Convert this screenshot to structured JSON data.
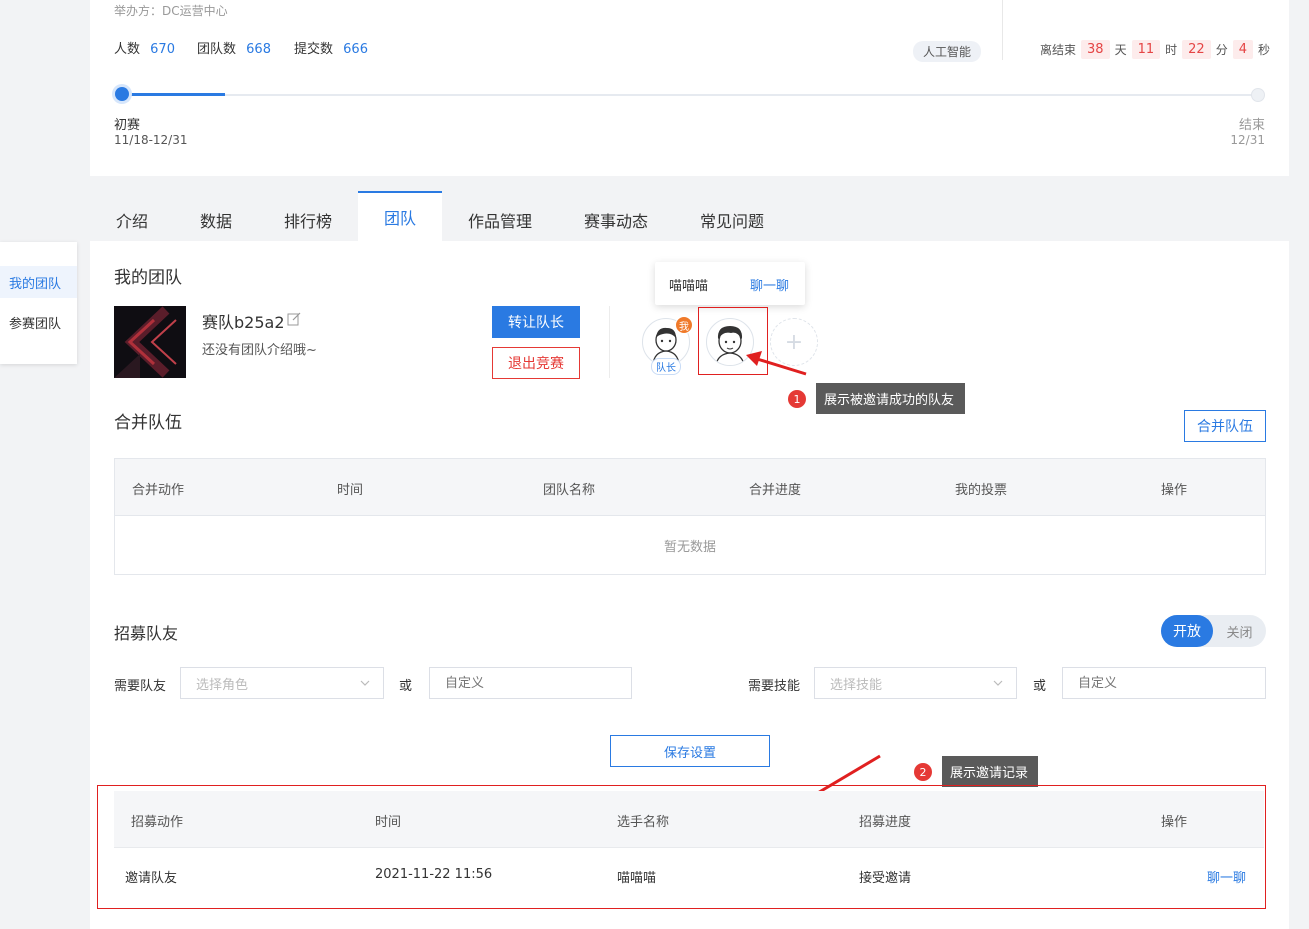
{
  "header": {
    "organizer": "举办方：DC运营中心",
    "stats": [
      {
        "label": "人数",
        "value": "670"
      },
      {
        "label": "团队数",
        "value": "668"
      },
      {
        "label": "提交数",
        "value": "666"
      }
    ],
    "tag": "人工智能",
    "countdown": {
      "prefix": "离结束",
      "days": "38",
      "days_unit": "天",
      "hours": "11",
      "hours_unit": "时",
      "minutes": "22",
      "minutes_unit": "分",
      "seconds": "4",
      "seconds_unit": "秒"
    },
    "timeline": {
      "progress": 0.09,
      "start_label": "初赛",
      "start_date": "11/18-12/31",
      "end_label": "结束",
      "end_date": "12/31"
    }
  },
  "tabs": [
    {
      "label": "介绍"
    },
    {
      "label": "数据"
    },
    {
      "label": "排行榜"
    },
    {
      "label": "团队",
      "active": true
    },
    {
      "label": "作品管理"
    },
    {
      "label": "赛事动态"
    },
    {
      "label": "常见问题"
    }
  ],
  "side_menu": [
    {
      "label": "我的团队",
      "active": true
    },
    {
      "label": "参赛团队"
    }
  ],
  "my_team": {
    "section_title": "我的团队",
    "name": "赛队b25a2",
    "desc": "还没有团队介绍哦~",
    "transfer_button": "转让队长",
    "quit_button": "退出竞赛",
    "me_badge": "我",
    "captain_tag": "队长",
    "popover_name": "喵喵喵",
    "popover_chat": "聊一聊"
  },
  "annotations": {
    "note1_num": "1",
    "note1_text": "展示被邀请成功的队友",
    "note2_num": "2",
    "note2_text": "展示邀请记录"
  },
  "merge": {
    "title": "合并队伍",
    "button": "合并队伍",
    "columns": [
      "合并动作",
      "时间",
      "团队名称",
      "合并进度",
      "我的投票",
      "操作"
    ],
    "empty": "暂无数据"
  },
  "recruit": {
    "title": "招募队友",
    "toggle_on": "开放",
    "toggle_off": "关闭",
    "need_teammate_label": "需要队友",
    "role_placeholder": "选择角色",
    "or1": "或",
    "custom1_placeholder": "自定义",
    "need_skill_label": "需要技能",
    "skill_placeholder": "选择技能",
    "or2": "或",
    "custom2_placeholder": "自定义",
    "save_button": "保存设置",
    "columns": [
      "招募动作",
      "时间",
      "选手名称",
      "招募进度",
      "操作"
    ],
    "rows": [
      {
        "action": "邀请队友",
        "time": "2021-11-22 11:56",
        "player": "喵喵喵",
        "progress": "接受邀请",
        "op": "聊一聊"
      }
    ]
  },
  "colors": {
    "accent": "#2a7ae2",
    "danger": "#e53935",
    "annotation_red": "#e02020"
  }
}
